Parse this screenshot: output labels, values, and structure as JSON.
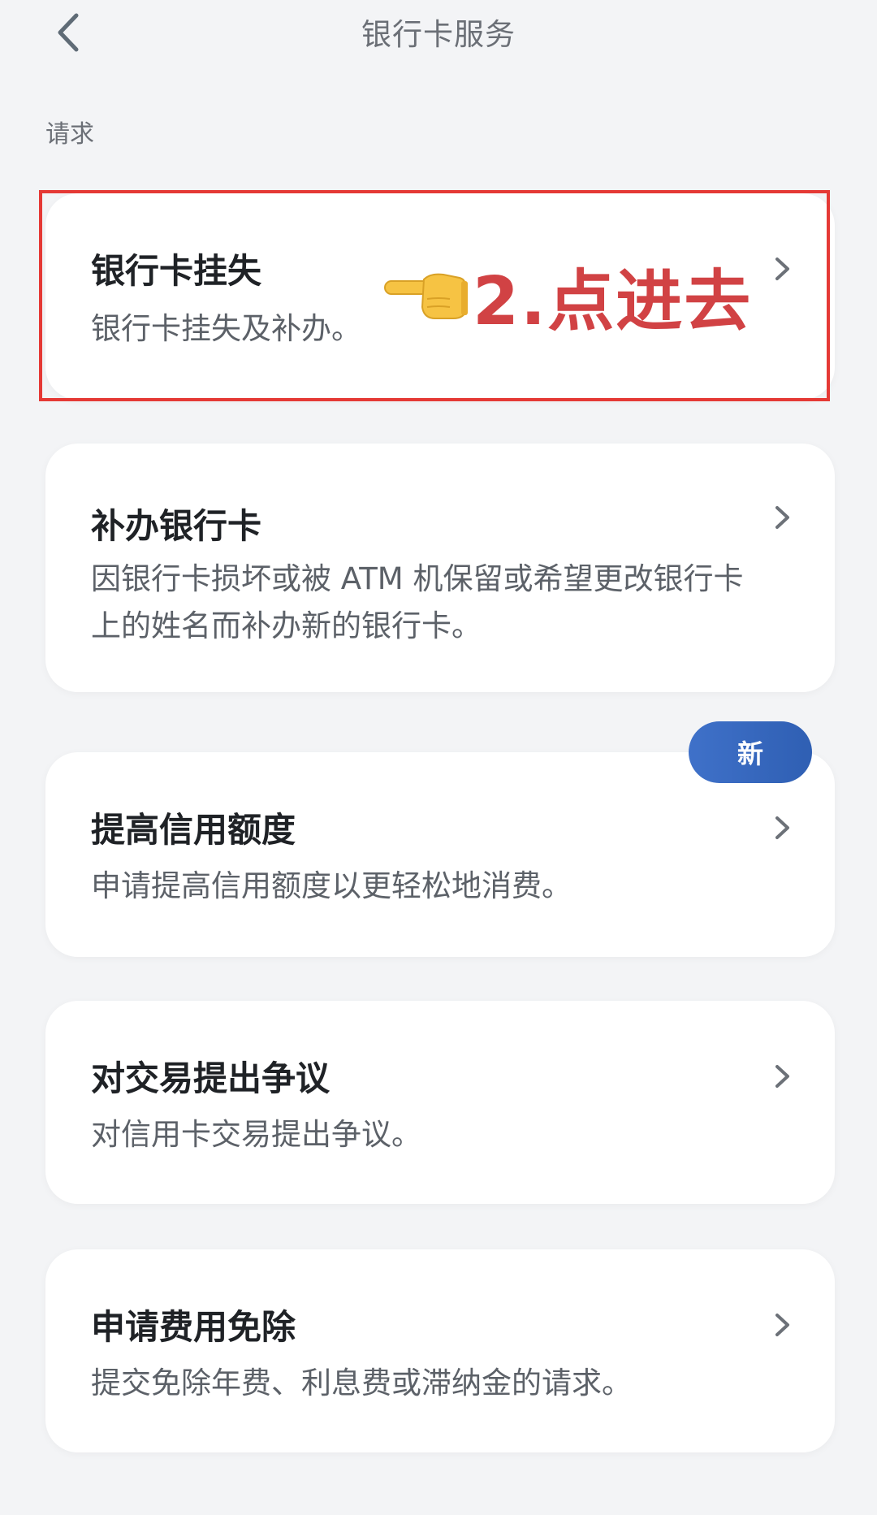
{
  "header": {
    "title": "银行卡服务",
    "back_icon": "chevron-left-icon"
  },
  "section": {
    "title": "请求"
  },
  "cards": [
    {
      "title": "银行卡挂失",
      "desc": "银行卡挂失及补办。"
    },
    {
      "title": "补办银行卡",
      "desc": "因银行卡损坏或被 ATM 机保留或希望更改银行卡上的姓名而补办新的银行卡。"
    },
    {
      "title": "提高信用额度",
      "desc": "申请提高信用额度以更轻松地消费。",
      "badge": "新"
    },
    {
      "title": "对交易提出争议",
      "desc": "对信用卡交易提出争议。"
    },
    {
      "title": "申请费用免除",
      "desc": "提交免除年费、利息费或滞纳金的请求。"
    }
  ],
  "annotation": {
    "text": "2.点进去",
    "icon": "pointing-hand-icon",
    "color": "#d14244",
    "highlight_color": "#e53935"
  },
  "colors": {
    "background": "#f3f4f6",
    "card": "#ffffff",
    "badge": "#3366bb"
  }
}
